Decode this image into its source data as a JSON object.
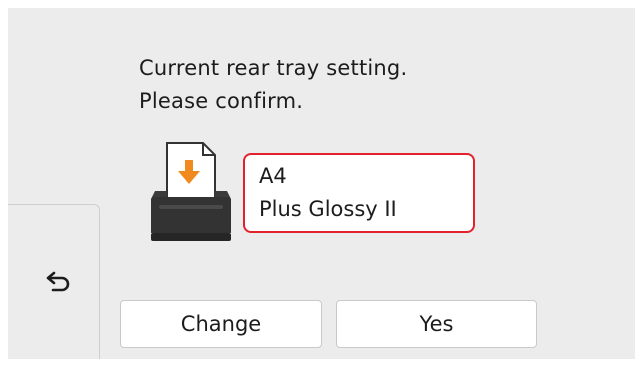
{
  "message": {
    "line1": "Current rear tray setting.",
    "line2": "Please confirm."
  },
  "paper_setting": {
    "size": "A4",
    "type": "Plus Glossy II"
  },
  "icons": {
    "tray": "rear-tray-paper-icon",
    "back": "back-arrow-icon"
  },
  "buttons": {
    "change_label": "Change",
    "yes_label": "Yes"
  },
  "colors": {
    "highlight_border": "#e2222c",
    "paper_arrow": "#f08a1e",
    "screen_background": "#ececec"
  }
}
